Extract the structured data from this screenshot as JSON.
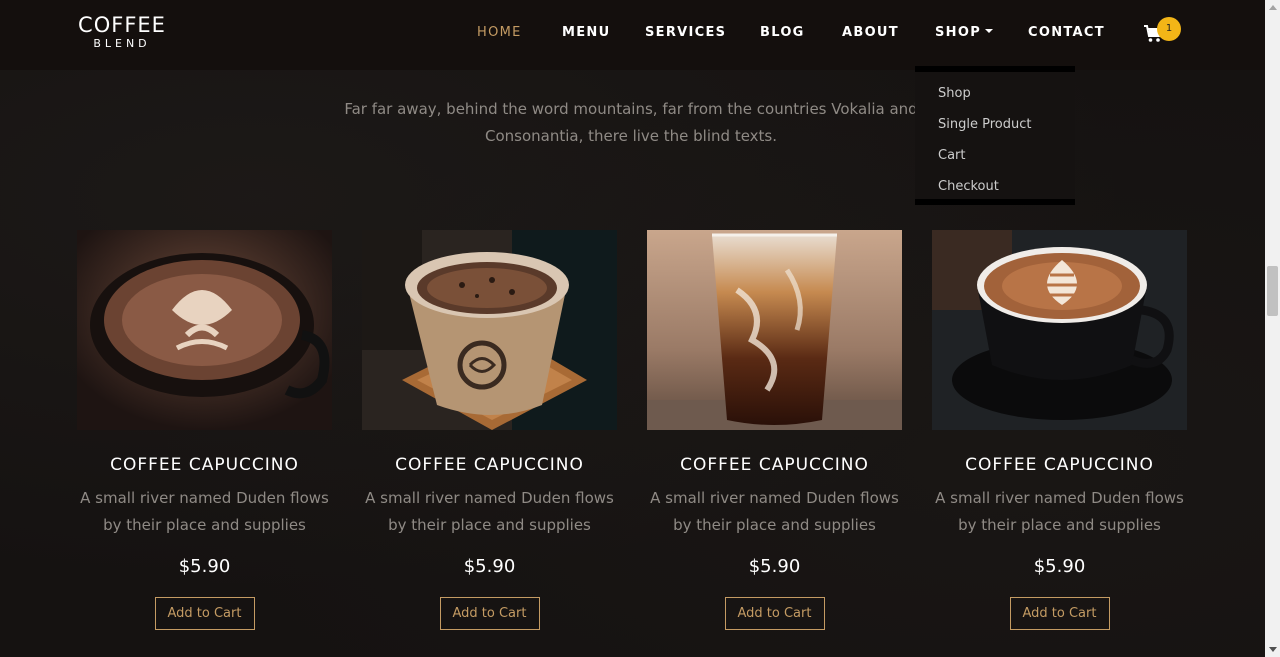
{
  "brand": {
    "top": "COFFEE",
    "bottom": "BLEND"
  },
  "nav": {
    "items": [
      {
        "label": "HOME",
        "active": true
      },
      {
        "label": "MENU"
      },
      {
        "label": "SERVICES"
      },
      {
        "label": "BLOG"
      },
      {
        "label": "ABOUT"
      },
      {
        "label": "SHOP"
      },
      {
        "label": "CONTACT"
      }
    ],
    "cart_icon": "cart-icon",
    "cart_count": "1"
  },
  "dropdown": {
    "items": [
      "Shop",
      "Single Product",
      "Cart",
      "Checkout"
    ]
  },
  "intro": {
    "line1": "Far far away, behind the word mountains, far from the countries Vokalia and",
    "line2": "Consonantia, there live the blind texts."
  },
  "products": [
    {
      "title": "COFFEE CAPUCCINO",
      "desc1": "A small river named Duden flows",
      "desc2": "by their place and supplies",
      "price": "$5.90",
      "button": "Add to Cart"
    },
    {
      "title": "COFFEE CAPUCCINO",
      "desc1": "A small river named Duden flows",
      "desc2": "by their place and supplies",
      "price": "$5.90",
      "button": "Add to Cart"
    },
    {
      "title": "COFFEE CAPUCCINO",
      "desc1": "A small river named Duden flows",
      "desc2": "by their place and supplies",
      "price": "$5.90",
      "button": "Add to Cart"
    },
    {
      "title": "COFFEE CAPUCCINO",
      "desc1": "A small river named Duden flows",
      "desc2": "by their place and supplies",
      "price": "$5.90",
      "button": "Add to Cart"
    }
  ],
  "colors": {
    "accent": "#c49b63",
    "badge": "#f2b517",
    "background": "#151211"
  }
}
